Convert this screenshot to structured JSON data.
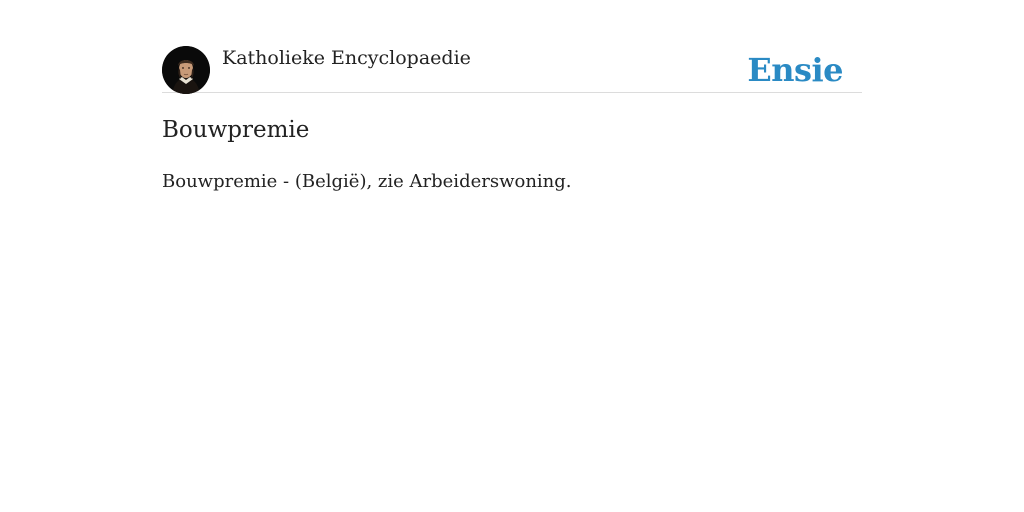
{
  "header": {
    "avatar_icon": "portrait-avatar-icon",
    "site_title": "Katholieke Encyclopaedie",
    "brand": "Ensie",
    "brand_color": "#2a8ac4"
  },
  "article": {
    "title": "Bouwpremie",
    "body_prefix": "Bouwpremie - (België), zie ",
    "body_link": "Arbeiderswoning",
    "body_suffix": "."
  }
}
